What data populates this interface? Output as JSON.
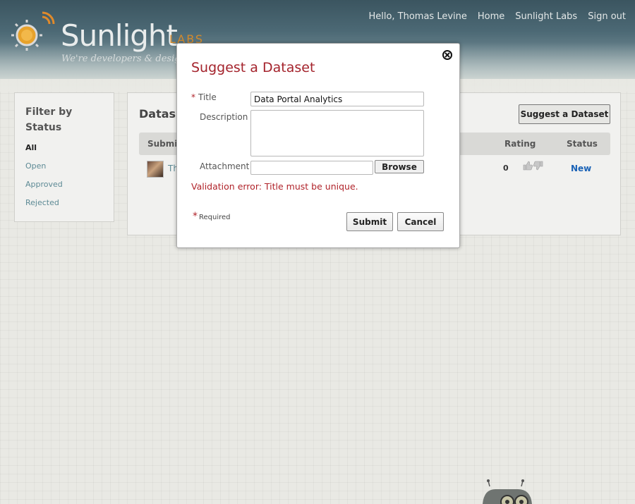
{
  "header": {
    "logo_text": "Sunlight",
    "logo_labs": "LABS",
    "tagline": "We're developers & designe",
    "nav": [
      "Hello, Thomas Levine",
      "Home",
      "Sunlight Labs",
      "Sign out"
    ]
  },
  "filter": {
    "title": "Filter by Status",
    "items": [
      {
        "label": "All",
        "active": true
      },
      {
        "label": "Open",
        "active": false
      },
      {
        "label": "Approved",
        "active": false
      },
      {
        "label": "Rejected",
        "active": false
      }
    ]
  },
  "main": {
    "title": "Datas",
    "suggest_button": "Suggest a Dataset",
    "columns": [
      "Submitt",
      "Rating",
      "Status"
    ],
    "rows": [
      {
        "name": "Th",
        "rating": "0",
        "status": "New"
      }
    ]
  },
  "modal": {
    "title": "Suggest a Dataset",
    "fields": {
      "title_label": "Title",
      "title_value": "Data Portal Analytics",
      "description_label": "Description",
      "description_value": "",
      "attachment_label": "Attachment",
      "attachment_value": "",
      "browse_label": "Browse"
    },
    "error": "Validation error: Title must be unique.",
    "required_note": "Required",
    "submit_label": "Submit",
    "cancel_label": "Cancel"
  },
  "colors": {
    "accent_red": "#a4232c",
    "link_teal": "#5d8a95",
    "status_blue": "#1a62b6"
  }
}
